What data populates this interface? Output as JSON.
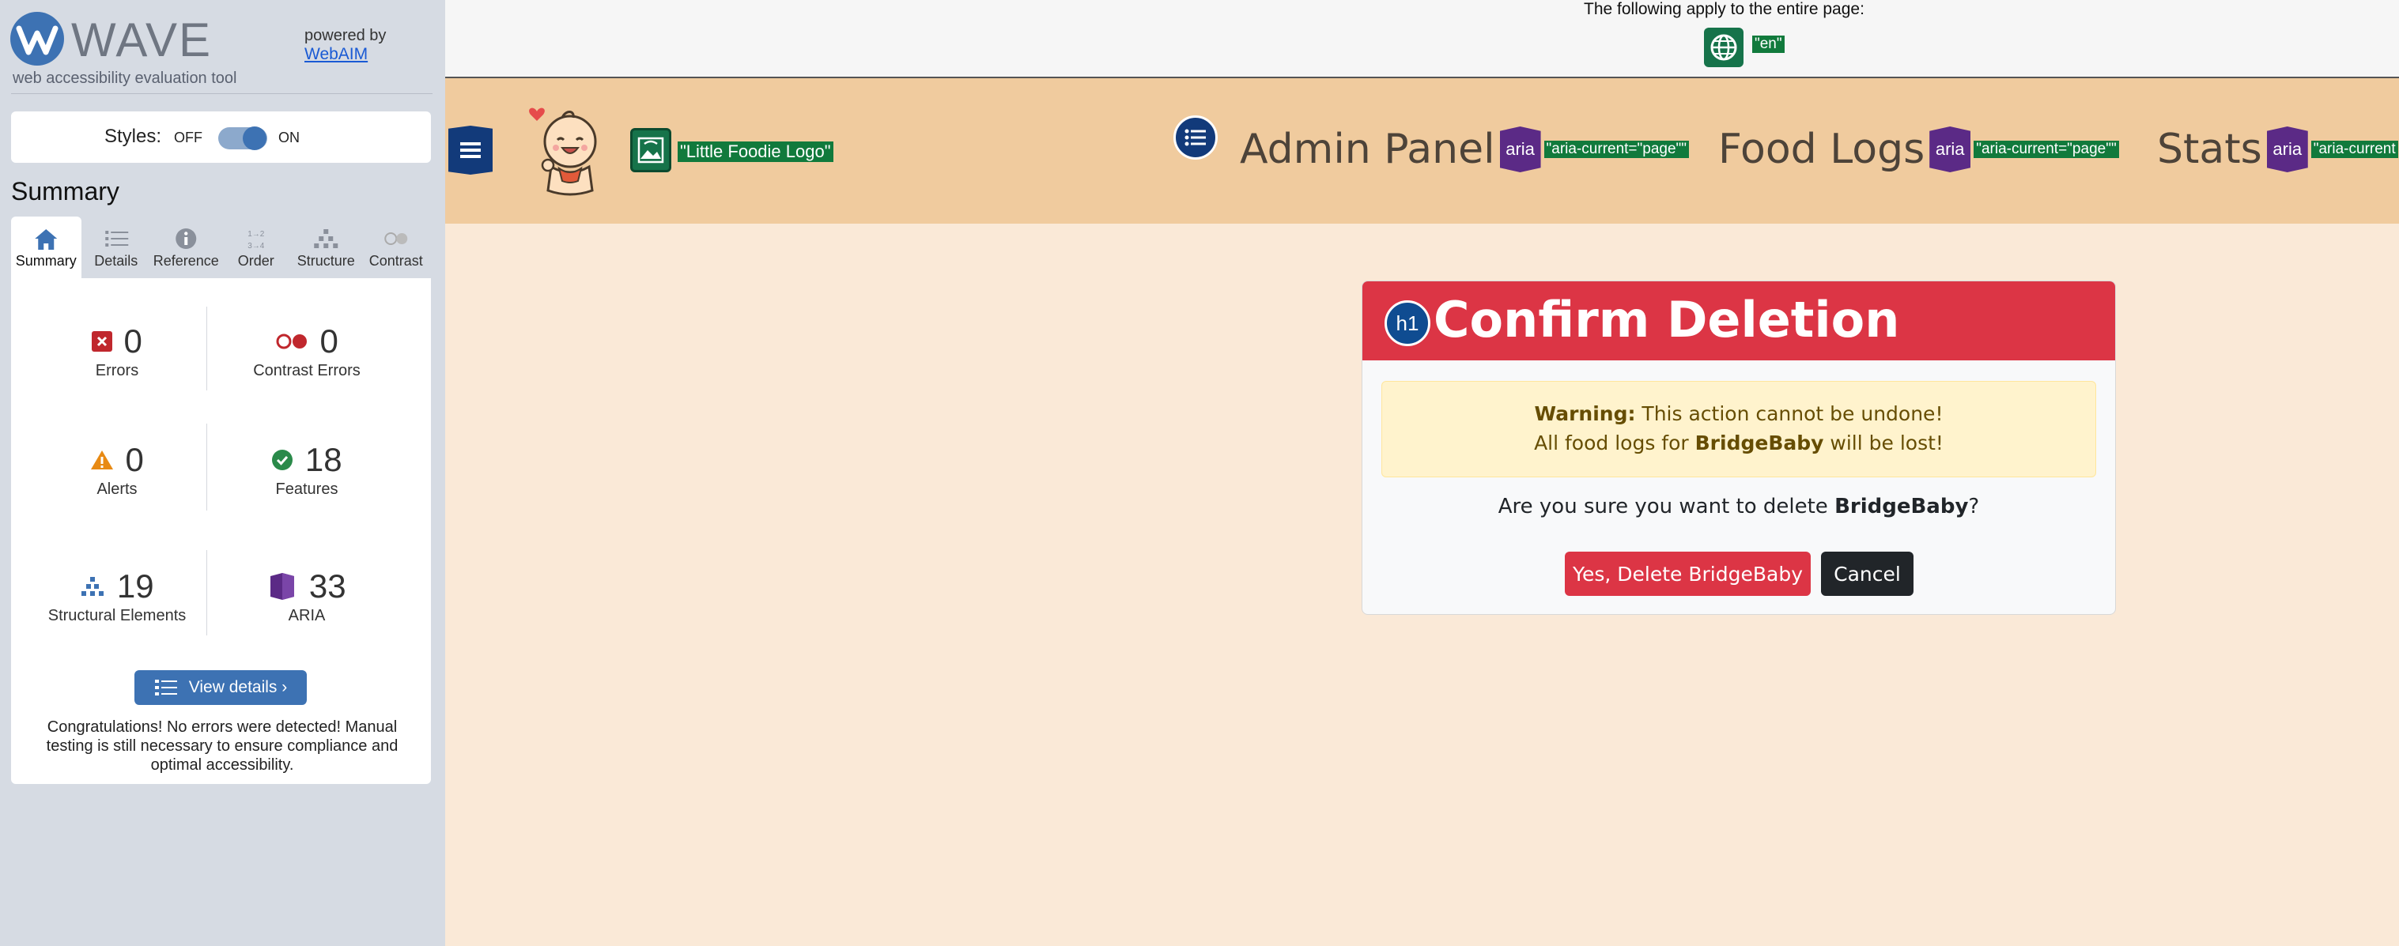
{
  "wave": {
    "logo_text": "WAVE",
    "tagline": "web accessibility evaluation tool",
    "powered_by": "powered by",
    "webaim_link": "WebAIM",
    "styles_label": "Styles:",
    "styles_off": "OFF",
    "styles_on": "ON",
    "styles_enabled": true,
    "summary_heading": "Summary",
    "tabs": [
      {
        "label": "Summary",
        "icon": "home-icon",
        "active": true
      },
      {
        "label": "Details",
        "icon": "list-icon",
        "active": false
      },
      {
        "label": "Reference",
        "icon": "info-icon",
        "active": false
      },
      {
        "label": "Order",
        "icon": "order-icon",
        "active": false
      },
      {
        "label": "Structure",
        "icon": "structure-icon",
        "active": false
      },
      {
        "label": "Contrast",
        "icon": "contrast-icon",
        "active": false
      }
    ],
    "stats": {
      "errors": {
        "count": "0",
        "label": "Errors"
      },
      "contrast_errors": {
        "count": "0",
        "label": "Contrast Errors"
      },
      "alerts": {
        "count": "0",
        "label": "Alerts"
      },
      "features": {
        "count": "18",
        "label": "Features"
      },
      "structural": {
        "count": "19",
        "label": "Structural Elements"
      },
      "aria": {
        "count": "33",
        "label": "ARIA"
      }
    },
    "view_details": "View details ›",
    "congrats": "Congratulations! No errors were detected! Manual testing is still necessary to ensure compliance and optimal accessibility."
  },
  "page_info": {
    "apply_text": "The following apply to the entire page:",
    "lang_tag": "\"en\""
  },
  "navbar": {
    "logo_alt_tag": "\"Little Foodie Logo\"",
    "items": [
      {
        "label": "Admin Panel",
        "aria_badge": "aria",
        "aria_tag": "\"aria-current=\"page\"\""
      },
      {
        "label": "Food Logs",
        "aria_badge": "aria",
        "aria_tag": "\"aria-current=\"page\"\""
      },
      {
        "label": "Stats",
        "aria_badge": "aria",
        "aria_tag": "\"aria-current"
      }
    ]
  },
  "card": {
    "h1_badge": "h1",
    "title": "Confirm Deletion",
    "warning_label": "Warning:",
    "warning_text": " This action cannot be undone!",
    "warning_line2_prefix": "All food logs for ",
    "warning_name": "BridgeBaby",
    "warning_line2_suffix": " will be lost!",
    "question_prefix": "Are you sure you want to delete ",
    "question_name": "BridgeBaby",
    "question_suffix": "?",
    "delete_button": "Yes, Delete BridgeBaby",
    "cancel_button": "Cancel"
  },
  "colors": {
    "wave_blue": "#3d72b3",
    "navbar_bg": "#f0cb9e",
    "page_bg": "#fae9d7",
    "danger": "#dc3545",
    "aria_purple": "#5b2a86",
    "tag_green": "#117a3c"
  }
}
